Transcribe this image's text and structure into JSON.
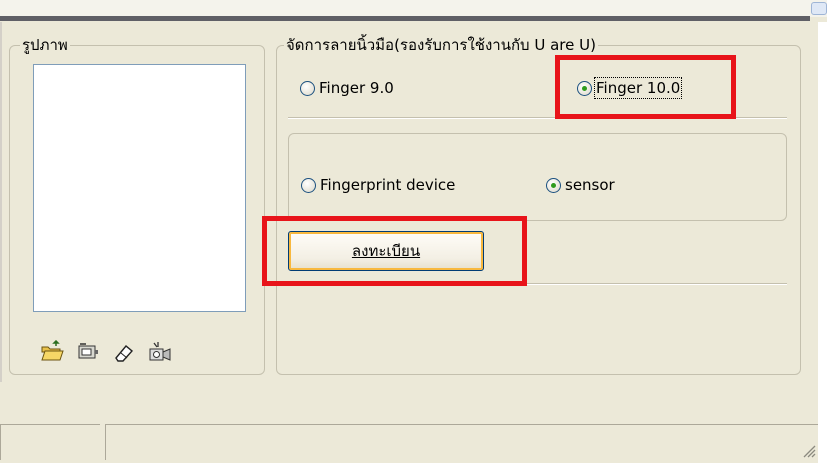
{
  "image_panel": {
    "legend": "รูปภาพ",
    "tools": [
      {
        "name": "open-folder-icon"
      },
      {
        "name": "scanner-icon"
      },
      {
        "name": "eraser-icon"
      },
      {
        "name": "camera-icon"
      }
    ]
  },
  "finger_panel": {
    "legend": "จัดการลายนิ้วมือ(รองรับการใช้งานกับ U are U)",
    "version_options": [
      {
        "label": "Finger 9.0",
        "checked": false
      },
      {
        "label": "Finger 10.0",
        "checked": true
      }
    ],
    "device_options": [
      {
        "label": "Fingerprint device",
        "checked": false
      },
      {
        "label": "sensor",
        "checked": true
      }
    ],
    "register_button": "ลงทะเบียน"
  },
  "colors": {
    "highlight": "#e8141a",
    "window": "#ECE9D8",
    "radio_checked": "#2f9b1e"
  }
}
